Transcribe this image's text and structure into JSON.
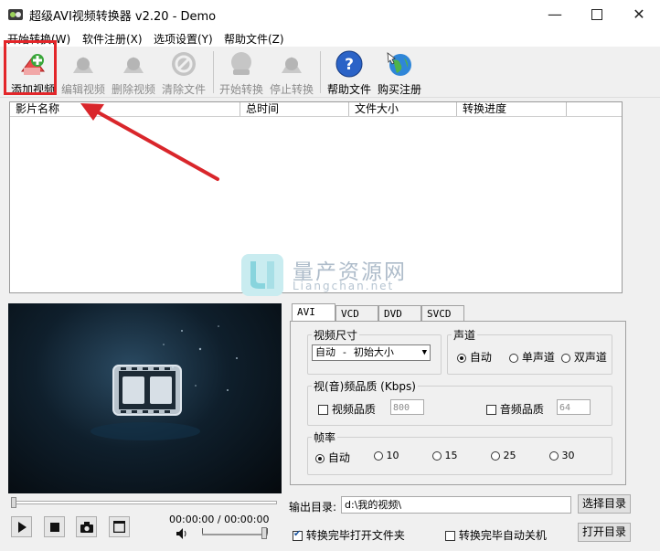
{
  "window": {
    "title": "超级AVI视频转换器 v2.20 - Demo",
    "minimize_icon": "minimize-icon",
    "maximize_icon": "maximize-icon",
    "close_icon": "close-icon"
  },
  "menu": [
    "开始转换(W)",
    "软件注册(X)",
    "选项设置(Y)",
    "帮助文件(Z)"
  ],
  "toolbar": {
    "add": "添加视频",
    "edit": "编辑视频",
    "delete": "删除视频",
    "clear": "清除文件",
    "start": "开始转换",
    "stop": "停止转换",
    "help": "帮助文件",
    "buy": "购买注册"
  },
  "list": {
    "columns": [
      "影片名称",
      "总时间",
      "文件大小",
      "转换进度"
    ]
  },
  "watermark": {
    "text": "量产资源网",
    "url": "Liangchan.net"
  },
  "tabs": [
    "AVI",
    "VCD",
    "DVD",
    "SVCD"
  ],
  "avi": {
    "video_size_label": "视频尺寸",
    "video_size_value": "自动 - 初始大小",
    "channel_label": "声道",
    "channel_options": [
      "自动",
      "单声道",
      "双声道"
    ],
    "quality_label": "视(音)频品质 (Kbps)",
    "video_quality_label": "视频品质",
    "video_quality_value": "800",
    "audio_quality_label": "音频品质",
    "audio_quality_value": "64",
    "framerate_label": "帧率",
    "framerate_options": [
      "自动",
      "10",
      "15",
      "25",
      "30"
    ]
  },
  "output": {
    "label": "输出目录:",
    "path": "d:\\我的视频\\",
    "select_button": "选择目录",
    "open_button": "打开目录",
    "open_after": "转换完毕打开文件夹",
    "shutdown_after": "转换完毕自动关机"
  },
  "player": {
    "time": "00:00:00 / 00:00:00"
  },
  "colors": {
    "highlight": "#e3262a",
    "arrow": "#d9262b"
  }
}
